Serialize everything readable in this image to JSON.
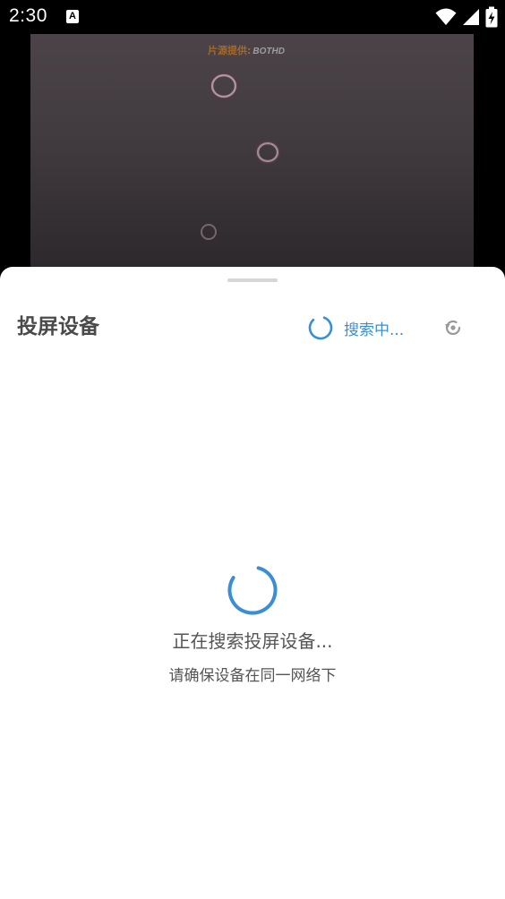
{
  "status_bar": {
    "time": "2:30",
    "notification_icon": "A",
    "icons": [
      "wifi-icon",
      "cellular-signal-icon",
      "battery-charging-icon"
    ]
  },
  "video": {
    "source_label": "片源提供:",
    "source_name": "BOTHD"
  },
  "sheet": {
    "title": "投屏设备",
    "search_status": "搜索中...",
    "refresh_icon": "refresh-icon",
    "empty_title": "正在搜索投屏设备...",
    "empty_hint": "请确保设备在同一网络下"
  },
  "colors": {
    "accent": "#3a8fd4",
    "title_text": "#4a4a4a",
    "body_text": "#555555",
    "sheet_background": "#ffffff"
  }
}
